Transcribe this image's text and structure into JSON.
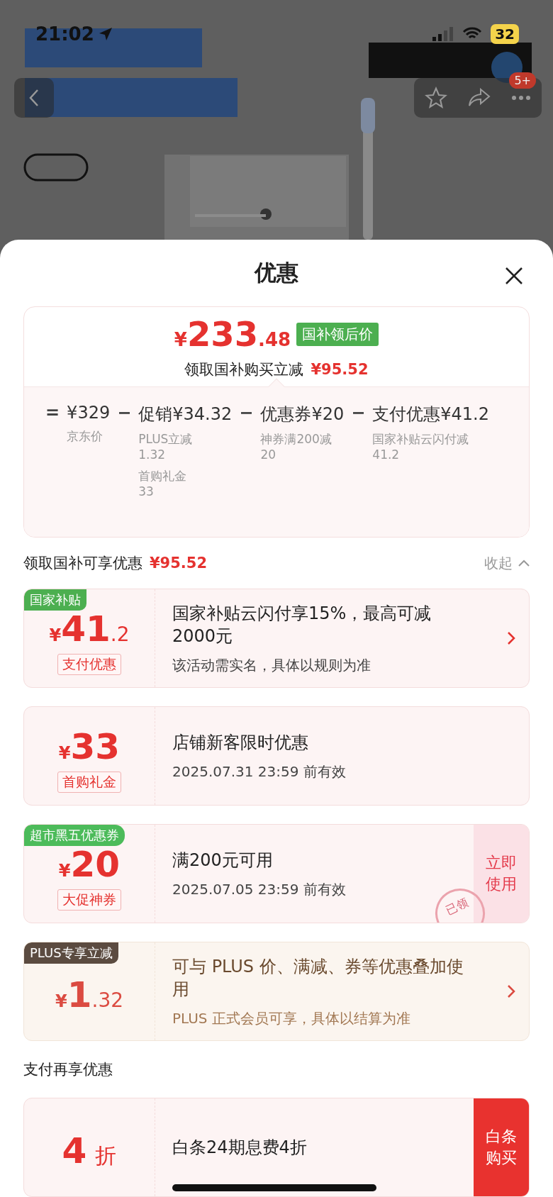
{
  "status_bar": {
    "time": "21:02",
    "battery": "32"
  },
  "nav": {
    "badge": "5+"
  },
  "sheet": {
    "title": "优惠"
  },
  "summary": {
    "price": {
      "prefix": "¥",
      "integer": "233",
      "suffix": ".48"
    },
    "price_tag": "国补领后价",
    "saving_label": "领取国补购买立减",
    "saving_amount": "¥95.52",
    "breakdown": [
      {
        "op": "=",
        "value": "¥329",
        "notes": [
          {
            "label": "京东价"
          }
        ]
      },
      {
        "op": "−",
        "value": "促销¥34.32",
        "notes": [
          {
            "label": "PLUS立减",
            "amount": "1.32"
          },
          {
            "label": "首购礼金",
            "amount": "33"
          }
        ]
      },
      {
        "op": "−",
        "value": "优惠券¥20",
        "notes": [
          {
            "label": "神券满200减",
            "amount": "20"
          }
        ]
      },
      {
        "op": "−",
        "value": "支付优惠¥41.2",
        "notes": [
          {
            "label": "国家补贴云闪付减",
            "amount": "41.2"
          }
        ]
      }
    ]
  },
  "sections": [
    {
      "title": "领取国补可享优惠",
      "amount": "¥95.52",
      "toggle": "收起",
      "expanded": true,
      "coupons": [
        {
          "kind": "standard",
          "chevron": true,
          "tag": {
            "text": "国家补贴",
            "color": "#4caf50",
            "kind": "square"
          },
          "amount": {
            "prefix": "¥",
            "integer": "41",
            "suffix": ".2"
          },
          "label": "支付优惠",
          "title": "国家补贴云闪付享15%，最高可减2000元",
          "subtitle": "该活动需实名，具体以规则为准"
        },
        {
          "kind": "standard",
          "chevron": false,
          "amount": {
            "prefix": "¥",
            "integer": "33"
          },
          "label": "首购礼金",
          "title": "店铺新客限时优惠",
          "subtitle": "2025.07.31 23:59 前有效"
        },
        {
          "kind": "standard",
          "chevron": false,
          "tag": {
            "text": "超市黑五优惠券",
            "color": "#4cbb5a",
            "kind": "pill"
          },
          "amount": {
            "prefix": "¥",
            "integer": "20"
          },
          "label": "大促神券",
          "title": "满200元可用",
          "subtitle": "2025.07.05 23:59 前有效",
          "action": {
            "text": "立即使用",
            "kind": "soft"
          },
          "stamp": "已领"
        },
        {
          "kind": "plus",
          "chevron": true,
          "tag": {
            "text": "PLUS专享立减",
            "color": "#5b4b40",
            "kind": "square"
          },
          "amount": {
            "prefix": "¥",
            "integer": "1",
            "suffix": ".32"
          },
          "title": "可与 PLUS 价、满减、券等优惠叠加使用",
          "subtitle": "PLUS 正式会员可享，具体以结算为准"
        }
      ]
    },
    {
      "title": "支付再享优惠",
      "coupons": [
        {
          "kind": "standard",
          "chevron": false,
          "amount": {
            "integer": "4",
            "suffix": "折"
          },
          "title": "白条24期息费4折",
          "action": {
            "text": "白条购买",
            "kind": "filled"
          }
        }
      ]
    }
  ]
}
